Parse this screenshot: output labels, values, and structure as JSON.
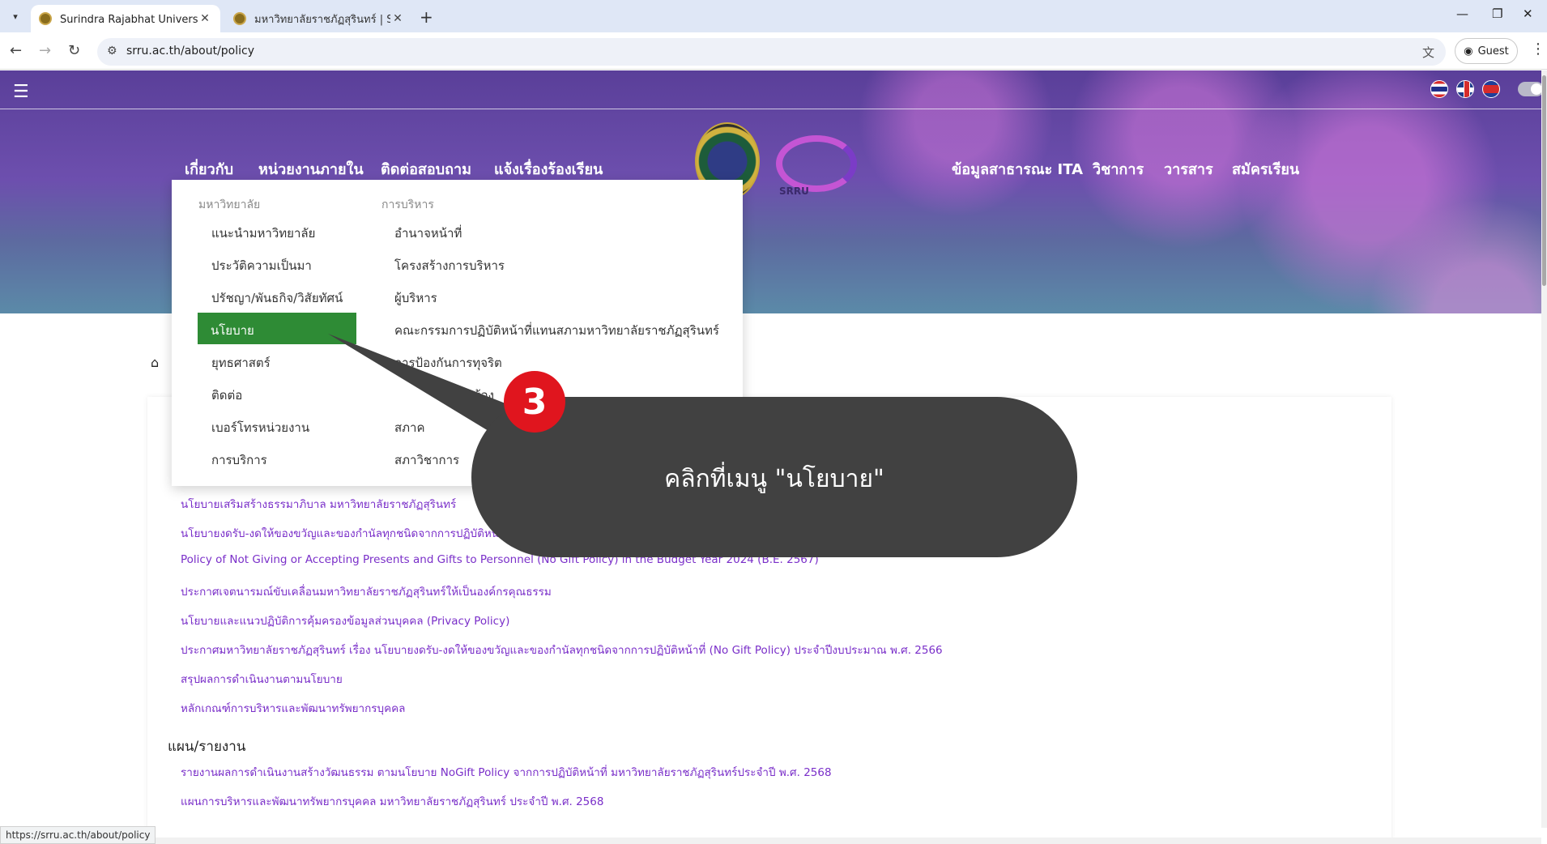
{
  "browser": {
    "tabs": [
      {
        "title": "Surindra Rajabhat University | ม",
        "active": true
      },
      {
        "title": "มหาวิทยาลัยราชภัฏสุรินทร์ | Surind",
        "active": false
      }
    ],
    "url": "srru.ac.th/about/policy",
    "profile_label": "Guest",
    "status_url": "https://srru.ac.th/about/policy"
  },
  "site": {
    "nav_left": [
      "เกี่ยวกับ",
      "หน่วยงานภายใน",
      "ติดต่อสอบถาม",
      "แจ้งเรื่องร้องเรียน"
    ],
    "nav_right": [
      "ข้อมูลสาธารณะ ITA",
      "วิชาการ",
      "วารสาร",
      "สมัครเรียน"
    ],
    "logo_text": "SRRU"
  },
  "dropdown": {
    "col1_header": "มหาวิทยาลัย",
    "col1_items": [
      "แนะนำมหาวิทยาลัย",
      "ประวัติความเป็นมา",
      "ปรัชญา/พันธกิจ/วิสัยทัศน์",
      "นโยบาย",
      "ยุทธศาสตร์",
      "ติดต่อ",
      "เบอร์โทรหน่วยงาน",
      "การบริการ"
    ],
    "col2_header": "การบริหาร",
    "col2_items": [
      "อำนาจหน้าที่",
      "โครงสร้างการบริหาร",
      "ผู้บริหาร",
      "คณะกรรมการปฏิบัติหน้าที่แทนสภามหาวิทยาลัยราชภัฏสุรินทร์",
      "การป้องกันการทุจริต",
      "เกี่ยวข้อง",
      "สภาค",
      "สภาวิชาการ"
    ],
    "active_item": "นโยบาย",
    "active_color": "#2e8b35"
  },
  "content": {
    "policy_links": [
      "นโยบายเสริมสร้างธรรมาภิบาล มหาวิทยาลัยราชภัฏสุรินทร์",
      "นโยบายงดรับ-งดให้ของขวัญและของกำนัลทุกชนิดจากการปฏิบัติหน้าที่",
      "Policy of Not Giving or Accepting Presents and Gifts to Personnel (No Gift Policy) in the Budget Year 2024 (B.E. 2567)",
      "ประกาศเจตนารมณ์ขับเคลื่อนมหาวิทยาลัยราชภัฏสุรินทร์ให้เป็นองค์กรคุณธรรม",
      "นโยบายและแนวปฏิบัติการคุ้มครองข้อมูลส่วนบุคคล (Privacy Policy)",
      "ประกาศมหาวิทยาลัยราชภัฏสุรินทร์ เรื่อง นโยบายงดรับ-งดให้ของขวัญและของกำนัลทุกชนิดจากการปฏิบัติหน้าที่ (No Gift Policy) ประจำปีงบประมาณ พ.ศ. 2566",
      "สรุปผลการดำเนินงานตามนโยบาย",
      "หลักเกณฑ์การบริหารและพัฒนาทรัพยากรบุคคล"
    ],
    "plans_heading": "แผน/รายงาน",
    "plan_links": [
      "รายงานผลการดำเนินงานสร้างวัฒนธรรม ตามนโยบาย NoGift Policy จากการปฏิบัติหน้าที่ มหาวิทยาลัยราชภัฏสุรินทร์ประจำปี พ.ศ. 2568",
      "แผนการบริหารและพัฒนาทรัพยากรบุคคล มหาวิทยาลัยราชภัฏสุรินทร์ ประจำปี พ.ศ. 2568"
    ],
    "link_color": "#7a2fc9"
  },
  "tutorial": {
    "step_number": "3",
    "instruction": "คลิกที่เมนู \"นโยบาย\"",
    "badge_color": "#e0151e",
    "bubble_color": "#414141"
  }
}
